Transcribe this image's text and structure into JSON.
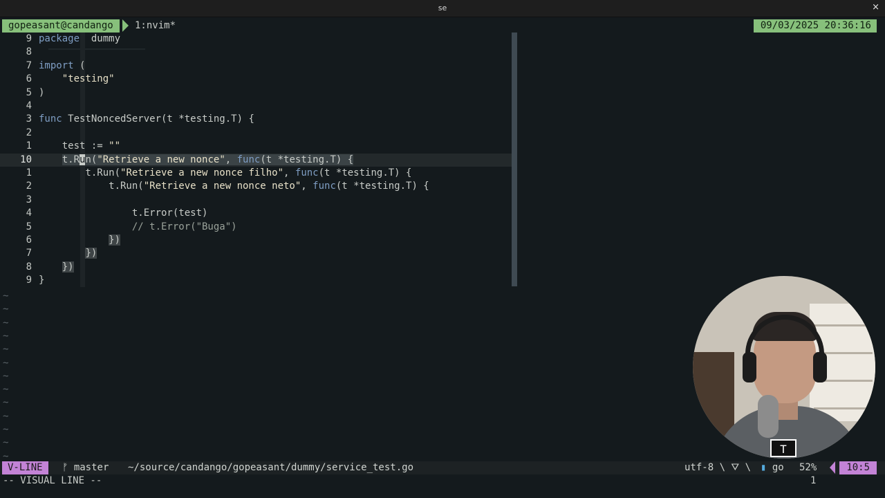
{
  "window": {
    "title": "se",
    "close_glyph": "×"
  },
  "tmux": {
    "session": "gopeasant@candango",
    "window": "1:nvim*",
    "datetime": "09/03/2025 20:36:16",
    "accent": "#87c07b"
  },
  "editor": {
    "lines": [
      {
        "num": "9",
        "tokens": [
          [
            "kw",
            "package"
          ],
          [
            "",
            "  dummy"
          ]
        ]
      },
      {
        "num": "8",
        "tokens": []
      },
      {
        "num": "7",
        "tokens": [
          [
            "kw",
            "import"
          ],
          [
            "",
            " ("
          ]
        ]
      },
      {
        "num": "6",
        "tokens": [
          [
            "",
            "    "
          ],
          [
            "str",
            "\"testing\""
          ]
        ]
      },
      {
        "num": "5",
        "tokens": [
          [
            "",
            ")"
          ]
        ]
      },
      {
        "num": "4",
        "tokens": []
      },
      {
        "num": "3",
        "tokens": [
          [
            "kw",
            "func"
          ],
          [
            "",
            " TestNoncedServer(t *testing.T) {"
          ]
        ]
      },
      {
        "num": "2",
        "tokens": []
      },
      {
        "num": "1",
        "tokens": [
          [
            "",
            "    test := "
          ],
          [
            "str",
            "\"\""
          ]
        ]
      },
      {
        "num": "10",
        "current": true,
        "tokens": [
          [
            "",
            "    "
          ],
          [
            "sel",
            "t.R"
          ],
          [
            "cursor",
            "u"
          ],
          [
            "sel",
            "n("
          ],
          [
            "sel str",
            "\"Retrieve a new nonce\""
          ],
          [
            "sel",
            ", "
          ],
          [
            "sel kw",
            "func"
          ],
          [
            "sel",
            "(t *testing.T) {"
          ]
        ]
      },
      {
        "num": "1",
        "tokens": [
          [
            "",
            "        t.Run("
          ],
          [
            "str",
            "\"Retrieve a new nonce filho\""
          ],
          [
            "",
            ", "
          ],
          [
            "kw",
            "func"
          ],
          [
            "",
            "(t *testing.T) {"
          ]
        ]
      },
      {
        "num": "2",
        "tokens": [
          [
            "",
            "            t.Run("
          ],
          [
            "str",
            "\"Retrieve a new nonce neto\""
          ],
          [
            "",
            ", "
          ],
          [
            "kw",
            "func"
          ],
          [
            "",
            "(t *testing.T) {"
          ]
        ]
      },
      {
        "num": "3",
        "tokens": []
      },
      {
        "num": "4",
        "tokens": [
          [
            "",
            "                t.Error(test)"
          ]
        ]
      },
      {
        "num": "5",
        "tokens": [
          [
            "cmt",
            "                // t.Error(\"Buga\")"
          ]
        ]
      },
      {
        "num": "6",
        "tokens": [
          [
            "",
            "            "
          ],
          [
            "brace",
            "})"
          ]
        ]
      },
      {
        "num": "7",
        "tokens": [
          [
            "",
            "        "
          ],
          [
            "brace",
            "})"
          ]
        ]
      },
      {
        "num": "8",
        "tokens": [
          [
            "",
            "    "
          ],
          [
            "brace",
            "})"
          ]
        ]
      },
      {
        "num": "9",
        "tokens": [
          [
            "",
            "}"
          ]
        ]
      }
    ],
    "tilde": "~"
  },
  "statusline": {
    "mode": "V-LINE",
    "branch": "ᚠ master",
    "path": "~/source/candango/gopeasant/dummy/service_test.go",
    "encoding": "utf-8 \\ ⛛ \\",
    "filetype_icon": "go-icon",
    "filetype": "go",
    "percent": "52%",
    "position": "10:5",
    "accent": "#c383d6"
  },
  "cmdline": {
    "text": "-- VISUAL LINE --",
    "count": "1"
  },
  "webcam": {
    "logo_text": "T"
  }
}
